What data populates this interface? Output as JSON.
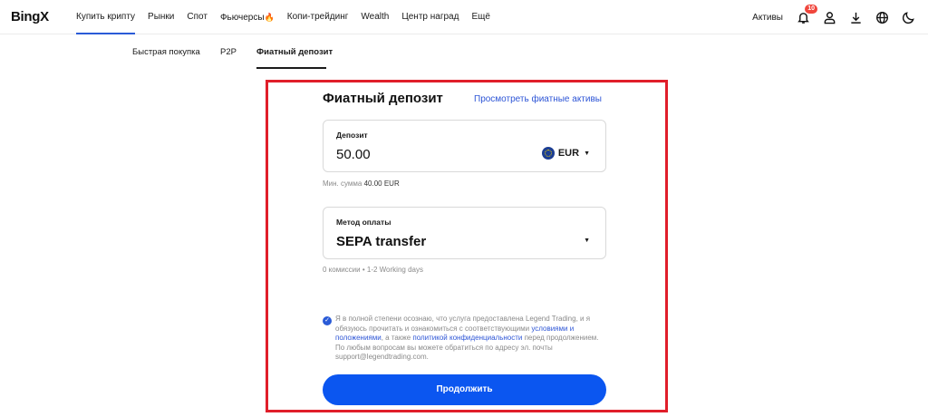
{
  "header": {
    "logo": "BingX",
    "nav": [
      {
        "label": "Купить крипту",
        "active": true
      },
      {
        "label": "Рынки"
      },
      {
        "label": "Спот"
      },
      {
        "label": "Фьючерсы",
        "icon": "fire-icon"
      },
      {
        "label": "Копи-трейдинг"
      },
      {
        "label": "Wealth"
      },
      {
        "label": "Центр наград"
      },
      {
        "label": "Ещё"
      }
    ],
    "assets_label": "Активы",
    "notification_count": "10"
  },
  "subtabs": [
    "Быстрая покупка",
    "P2P",
    "Фиатный депозит"
  ],
  "form": {
    "title": "Фиатный депозит",
    "view_link": "Просмотреть фиатные активы",
    "deposit": {
      "label": "Депозит",
      "value": "50.00",
      "currency": "EUR"
    },
    "min_sum_label": "Мин. сумма",
    "min_sum_value": "40.00 EUR",
    "payment": {
      "label": "Метод оплаты",
      "value": "SEPA transfer"
    },
    "payment_hint": "0 комиссии • 1-2 Working days",
    "consent": {
      "part1": "Я в полной степени осознаю, что услуга предоставлена Legend Trading, и я обязуюсь прочитать и ознакомиться с соответствующими ",
      "link1": "условиями и положениями",
      "part2": ", а также ",
      "link2": "политикой конфиденциальности",
      "part3": " перед продолжением. По любым вопросам вы можете обратиться по адресу эл. почты support@legendtrading.com."
    },
    "continue_label": "Продолжить"
  },
  "colors": {
    "accent": "#0b56f0",
    "link": "#2d55d6",
    "highlight": "#e01e2a",
    "badge": "#f0463c"
  }
}
